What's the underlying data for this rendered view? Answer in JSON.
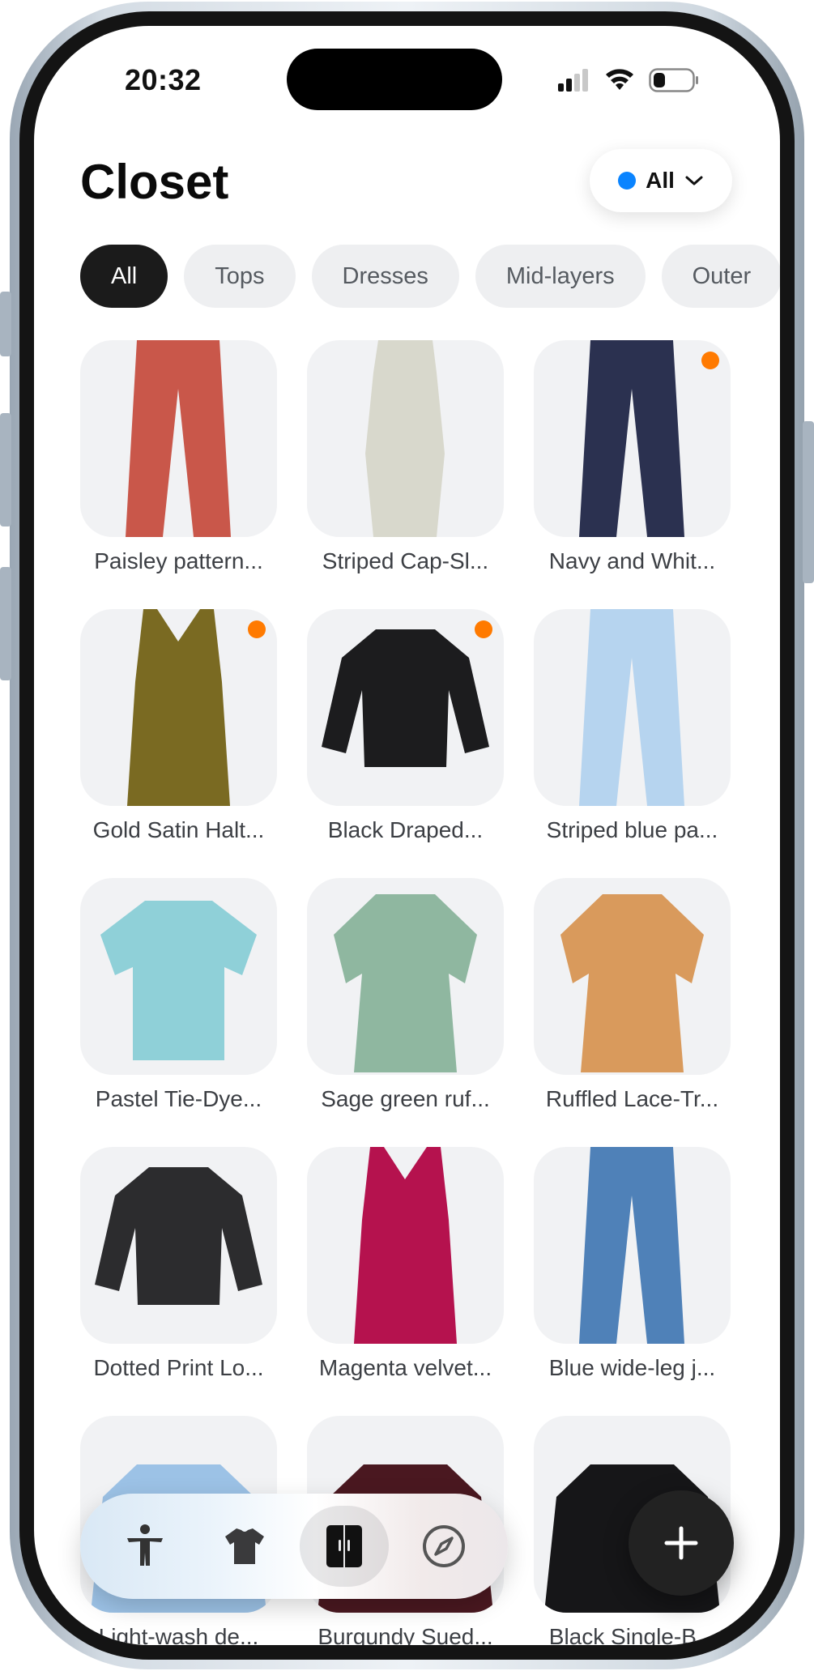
{
  "status_bar": {
    "time": "20:32"
  },
  "header": {
    "title": "Closet",
    "filter": {
      "label": "All",
      "dot_color": "#0a84ff"
    }
  },
  "chips": [
    {
      "label": "All",
      "active": true
    },
    {
      "label": "Tops",
      "active": false
    },
    {
      "label": "Dresses",
      "active": false
    },
    {
      "label": "Mid-layers",
      "active": false
    },
    {
      "label": "Outer",
      "active": false
    }
  ],
  "items": [
    {
      "label": "Paisley pattern...",
      "badge": false,
      "kind": "pants",
      "color": "#c9574a"
    },
    {
      "label": "Striped Cap-Sl...",
      "badge": false,
      "kind": "dress",
      "color": "#d8d8cc"
    },
    {
      "label": "Navy and Whit...",
      "badge": true,
      "kind": "pants",
      "color": "#2b3150"
    },
    {
      "label": "Gold Satin Halt...",
      "badge": true,
      "kind": "tank",
      "color": "#7a6a22"
    },
    {
      "label": "Black Draped...",
      "badge": true,
      "kind": "longsleeve",
      "color": "#1c1c1e"
    },
    {
      "label": "Striped blue pa...",
      "badge": false,
      "kind": "pants",
      "color": "#b6d4ef"
    },
    {
      "label": "Pastel Tie-Dye...",
      "badge": false,
      "kind": "shirt",
      "color": "#8fd0d8"
    },
    {
      "label": "Sage green ruf...",
      "badge": false,
      "kind": "blouse",
      "color": "#8fb7a0"
    },
    {
      "label": "Ruffled Lace-Tr...",
      "badge": false,
      "kind": "blouse",
      "color": "#d99a5c"
    },
    {
      "label": "Dotted Print Lo...",
      "badge": false,
      "kind": "longsleeve",
      "color": "#2c2c2e"
    },
    {
      "label": "Magenta velvet...",
      "badge": false,
      "kind": "tank",
      "color": "#b5124e"
    },
    {
      "label": "Blue wide-leg j...",
      "badge": false,
      "kind": "pants",
      "color": "#4f81b8"
    },
    {
      "label": "Light-wash de...",
      "badge": false,
      "kind": "jacket",
      "color": "#9cc2e6"
    },
    {
      "label": "Burgundy Sued...",
      "badge": false,
      "kind": "jacket",
      "color": "#4a1820"
    },
    {
      "label": "Black Single-B...",
      "badge": false,
      "kind": "jacket",
      "color": "#161618"
    }
  ],
  "tabbar": {
    "tabs": [
      {
        "icon": "person-icon",
        "active": false
      },
      {
        "icon": "tshirt-icon",
        "active": false
      },
      {
        "icon": "closet-icon",
        "active": true
      },
      {
        "icon": "compass-icon",
        "active": false
      }
    ]
  },
  "fab": {
    "icon": "plus-icon"
  },
  "colors": {
    "badge": "#ff7a00",
    "accent": "#0a84ff"
  }
}
